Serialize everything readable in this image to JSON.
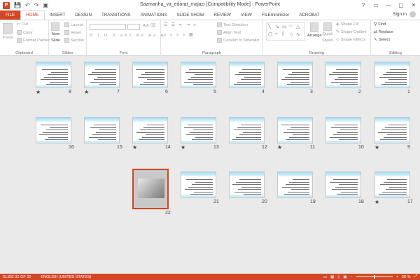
{
  "window": {
    "title": "Sazmanha_va_edarat_majazi [Compatibility Mode] - PowerPoint",
    "controls": [
      "?",
      "▭",
      "—",
      "▢",
      "✕"
    ]
  },
  "qat": {
    "save": "💾",
    "undo": "↶",
    "redo": "↷",
    "start": "▣"
  },
  "tabs": [
    "FILE",
    "HOME",
    "INSERT",
    "DESIGN",
    "TRANSITIONS",
    "ANIMATIONS",
    "SLIDE SHOW",
    "REVIEW",
    "VIEW",
    "FILEminimizer",
    "ACROBAT"
  ],
  "active_tab": "HOME",
  "account": {
    "signin": "Sign in"
  },
  "ribbon": {
    "clipboard": {
      "label": "Clipboard",
      "paste": "Paste",
      "cut": "Cut",
      "copy": "Copy",
      "format_painter": "Format Painter"
    },
    "slides": {
      "label": "Slides",
      "new_slide": "New",
      "new_slide2": "Slide",
      "layout": "Layout",
      "reset": "Reset",
      "section": "Section"
    },
    "font": {
      "label": "Font"
    },
    "paragraph": {
      "label": "Paragraph",
      "text_direction": "Text Direction",
      "align_text": "Align Text",
      "smartart": "Convert to SmartArt"
    },
    "drawing": {
      "label": "Drawing",
      "arrange": "Arrange",
      "quick_styles": "Quick",
      "quick_styles2": "Styles",
      "shape_fill": "Shape Fill",
      "shape_outline": "Shape Outline",
      "shape_effects": "Shape Effects"
    },
    "editing": {
      "label": "Editing",
      "find": "Find",
      "replace": "Replace",
      "select": "Select"
    }
  },
  "slides": [
    {
      "num": "1",
      "star": ""
    },
    {
      "num": "2",
      "star": ""
    },
    {
      "num": "3",
      "star": ""
    },
    {
      "num": "4",
      "star": ""
    },
    {
      "num": "5",
      "star": ""
    },
    {
      "num": "6",
      "star": ""
    },
    {
      "num": "7",
      "star": "★"
    },
    {
      "num": "8",
      "star": "★"
    },
    {
      "num": "9",
      "star": "★"
    },
    {
      "num": "10",
      "star": ""
    },
    {
      "num": "11",
      "star": "★"
    },
    {
      "num": "12",
      "star": ""
    },
    {
      "num": "13",
      "star": "★"
    },
    {
      "num": "14",
      "star": "★"
    },
    {
      "num": "15",
      "star": ""
    },
    {
      "num": "16",
      "star": ""
    },
    {
      "num": "17",
      "star": "★"
    },
    {
      "num": "18",
      "star": ""
    },
    {
      "num": "19",
      "star": ""
    },
    {
      "num": "20",
      "star": ""
    },
    {
      "num": "21",
      "star": ""
    },
    {
      "num": "22",
      "star": ""
    }
  ],
  "status": {
    "slide": "SLIDE 22 OF 22",
    "language": "ENGLISH (UNITED STATES)",
    "zoom": "50 %",
    "zoom_level": 0.5
  }
}
